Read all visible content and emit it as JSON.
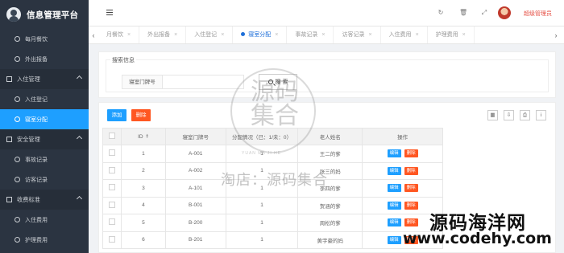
{
  "app": {
    "title": "信息管理平台"
  },
  "sidebar": {
    "items": [
      {
        "label": "每月餐饮",
        "icon": "camera-icon",
        "type": "item"
      },
      {
        "label": "外出报备",
        "icon": "camera-icon",
        "type": "item"
      },
      {
        "label": "入住管理",
        "icon": "checkin-icon",
        "type": "group"
      },
      {
        "label": "入住登记",
        "icon": "camera-icon",
        "type": "sub"
      },
      {
        "label": "寝室分配",
        "icon": "camera-icon",
        "type": "sub-active"
      },
      {
        "label": "安全管理",
        "icon": "calendar-icon",
        "type": "group"
      },
      {
        "label": "事故记录",
        "icon": "document-icon",
        "type": "sub"
      },
      {
        "label": "访客记录",
        "icon": "chat-icon",
        "type": "sub"
      },
      {
        "label": "收费标准",
        "icon": "flag-icon",
        "type": "group"
      },
      {
        "label": "入住费用",
        "icon": "gear-icon",
        "type": "sub"
      },
      {
        "label": "护理费用",
        "icon": "tag-icon",
        "type": "sub"
      }
    ]
  },
  "header": {
    "user_name": "超级管理员"
  },
  "tabs": [
    {
      "label": "月餐饮",
      "active": false
    },
    {
      "label": "外出报备",
      "active": false
    },
    {
      "label": "入住登记",
      "active": false
    },
    {
      "label": "寝室分配",
      "active": true
    },
    {
      "label": "事故记录",
      "active": false
    },
    {
      "label": "访客记录",
      "active": false
    },
    {
      "label": "入住费用",
      "active": false
    },
    {
      "label": "护理费用",
      "active": false
    }
  ],
  "search": {
    "legend": "搜索信息",
    "field_label": "寝室门牌号",
    "field_value": "",
    "button_label": "搜 索"
  },
  "toolbar": {
    "add_label": "添加",
    "delete_label": "删除"
  },
  "table": {
    "columns": [
      "ID",
      "寝室门牌号",
      "分配情况（已：1/未：0）",
      "老人姓名",
      "操作"
    ],
    "edit_label": "编辑",
    "delete_label": "删除",
    "rows": [
      {
        "id": "1",
        "room": "A-001",
        "status": "1",
        "name": "王二的爹"
      },
      {
        "id": "2",
        "room": "A-002",
        "status": "1",
        "name": "张三的妈"
      },
      {
        "id": "3",
        "room": "A-101",
        "status": "1",
        "name": "李四的爹"
      },
      {
        "id": "4",
        "room": "B-001",
        "status": "1",
        "name": "贺涵的爹"
      },
      {
        "id": "5",
        "room": "B-200",
        "status": "1",
        "name": "周松的爹"
      },
      {
        "id": "6",
        "room": "B-201",
        "status": "1",
        "name": "黄宇豪的妈"
      }
    ]
  },
  "watermark": {
    "seal_text": "源码",
    "seal_sub": "YUAN MA JI HE",
    "seal_text_2": "集合",
    "shop_text": "淘店：源码集合",
    "site_cn": "源码海洋网",
    "site_url": "www.codehy.com"
  }
}
